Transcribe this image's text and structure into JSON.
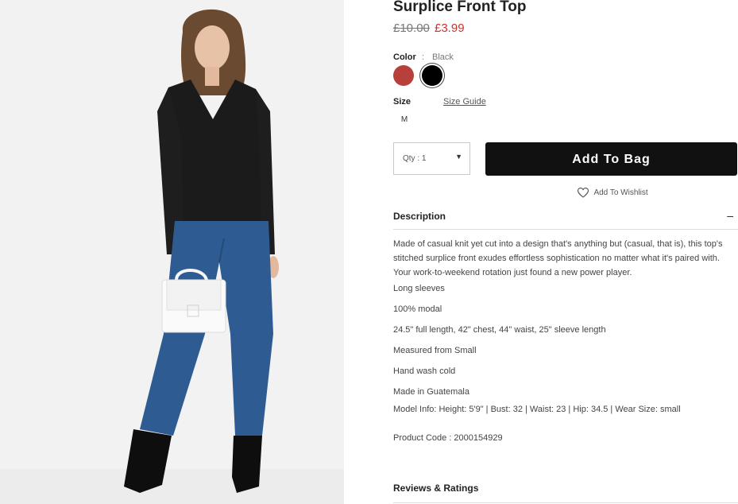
{
  "product": {
    "title": "Surplice Front Top",
    "price_original": "£10.00",
    "price_sale": "£3.99"
  },
  "color": {
    "label": "Color",
    "separator": ":",
    "selected": "Black",
    "swatches": [
      {
        "name": "red",
        "hex": "#b8403b"
      },
      {
        "name": "Black",
        "hex": "#000000"
      }
    ]
  },
  "size": {
    "label": "Size",
    "guide_link": "Size Guide",
    "options": [
      "M"
    ]
  },
  "quantity": {
    "label": "Qty : 1"
  },
  "actions": {
    "add_to_bag": "Add To Bag",
    "wishlist": "Add To Wishlist"
  },
  "description": {
    "title": "Description",
    "toggle": "–",
    "paragraph": "Made of casual knit yet cut into a design that's anything but (casual, that is), this top's stitched surplice front exudes effortless sophistication no matter what it's paired with. Your work-to-weekend rotation just found a new power player.",
    "details": [
      "Long sleeves",
      "100% modal",
      "24.5\" full length, 42\" chest, 44\" waist, 25\" sleeve length",
      "Measured from Small",
      "Hand wash cold",
      "Made in Guatemala",
      "Model Info: Height: 5'9\" | Bust: 32 | Waist: 23 | Hip: 34.5 | Wear Size: small"
    ],
    "product_code": "Product Code : 2000154929"
  },
  "reviews": {
    "title": "Reviews & Ratings"
  },
  "colors": {
    "sale_price": "#d0312d",
    "button_bg": "#111111",
    "top": "#1a1a1a",
    "jeans": "#2f5b93"
  }
}
